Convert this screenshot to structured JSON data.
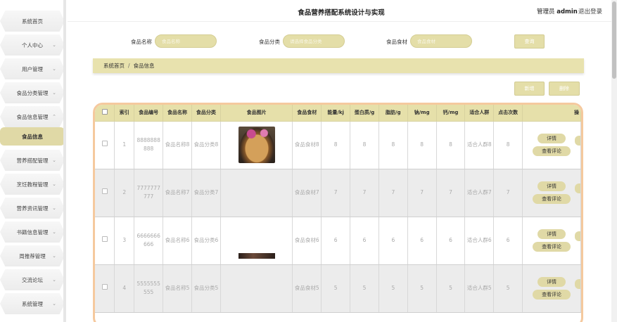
{
  "header": {
    "title": "食品营养搭配系统设计与实现",
    "role": "管理员",
    "username": "admin",
    "logout": "退出登录"
  },
  "sidebar": {
    "items": [
      {
        "label": "系统首页",
        "chevron": false
      },
      {
        "label": "个人中心",
        "chevron": true
      },
      {
        "label": "用户管理",
        "chevron": true
      },
      {
        "label": "食品分类管理",
        "chevron": true
      },
      {
        "label": "食品信息管理",
        "chevron": true,
        "expanded": true
      },
      {
        "label": "食品信息",
        "chevron": false,
        "active": true
      },
      {
        "label": "营养搭配管理",
        "chevron": true
      },
      {
        "label": "烹饪教程管理",
        "chevron": true
      },
      {
        "label": "营养资讯管理",
        "chevron": true
      },
      {
        "label": "书籍信息管理",
        "chevron": true
      },
      {
        "label": "周推荐管理",
        "chevron": true
      },
      {
        "label": "交流论坛",
        "chevron": true
      },
      {
        "label": "系统管理",
        "chevron": true
      }
    ]
  },
  "search": {
    "name_label": "食品名称",
    "name_placeholder": "食品名称",
    "category_label": "食品分类",
    "category_placeholder": "请选择食品分类",
    "ingredient_label": "食品食材",
    "ingredient_placeholder": "食品食材",
    "query_button": "查询"
  },
  "breadcrumb": {
    "home": "系统首页",
    "separator": "/",
    "current": "食品信息"
  },
  "actions": {
    "add": "新增",
    "delete": "删除"
  },
  "table": {
    "columns": [
      "索引",
      "食品编号",
      "食品名称",
      "食品分类",
      "食品图片",
      "食品食材",
      "能量/kj",
      "蛋白质/g",
      "脂肪/g",
      "钠/mg",
      "钙/mg",
      "适合人群",
      "点击次数",
      "操"
    ],
    "detail_label": "详情",
    "review_label": "查看评论",
    "rows": [
      {
        "index": "1",
        "code": "8888888888",
        "name": "食品名称8",
        "category": "食品分类8",
        "image": "food1",
        "ingredient": "食品食材8",
        "energy": "8",
        "protein": "8",
        "fat": "8",
        "sodium": "8",
        "calcium": "8",
        "crowd": "适合人群8",
        "clicks": "8"
      },
      {
        "index": "2",
        "code": "7777777777",
        "name": "食品名称7",
        "category": "食品分类7",
        "image": "",
        "ingredient": "食品食材7",
        "energy": "7",
        "protein": "7",
        "fat": "7",
        "sodium": "7",
        "calcium": "7",
        "crowd": "适合人群7",
        "clicks": "7"
      },
      {
        "index": "3",
        "code": "6666666666",
        "name": "食品名称6",
        "category": "食品分类6",
        "image": "",
        "ingredient": "食品食材6",
        "energy": "6",
        "protein": "6",
        "fat": "6",
        "sodium": "6",
        "calcium": "6",
        "crowd": "适合人群6",
        "clicks": "6"
      },
      {
        "index": "4",
        "code": "5555555555",
        "name": "食品名称5",
        "category": "食品分类5",
        "image": "food4",
        "ingredient": "食品食材5",
        "energy": "5",
        "protein": "5",
        "fat": "5",
        "sodium": "5",
        "calcium": "5",
        "crowd": "适合人群5",
        "clicks": "5"
      }
    ]
  },
  "colors": {
    "accent": "#e4dea8",
    "table_border": "#f5c99e"
  }
}
